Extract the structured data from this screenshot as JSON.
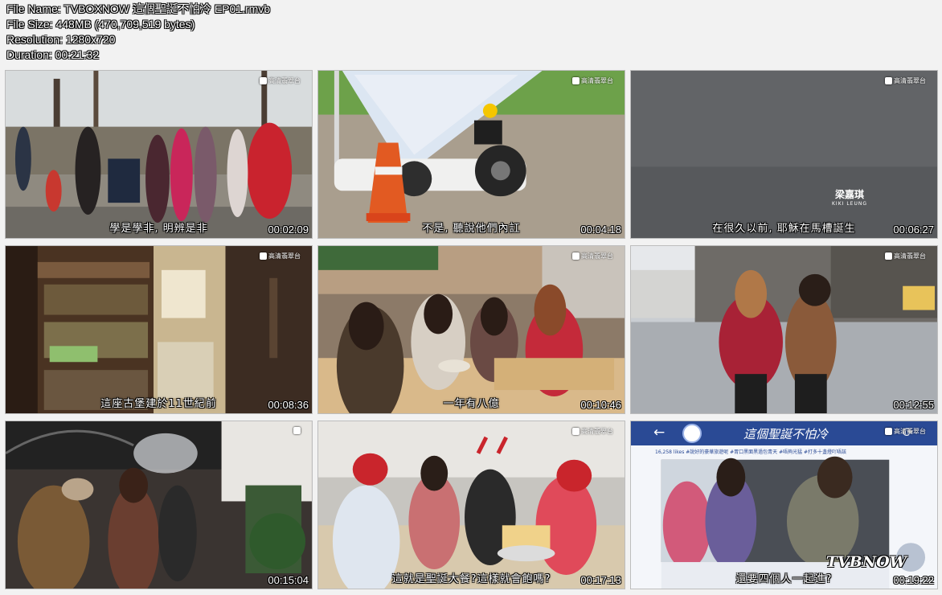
{
  "file_info": {
    "file_name": "File Name: TVBOXNOW 這個聖誕不怕冷 EP01.rmvb",
    "file_size": "File Size: 448MB (470,709,519 bytes)",
    "resolution": "Resolution: 1280x720",
    "duration": "Duration: 00:21:32"
  },
  "channel_logo_text": "高清翡翠台",
  "thumbnails": [
    {
      "timecode": "00:02:09",
      "subtitle": "學是學非, 明辨是非"
    },
    {
      "timecode": "00:04:18",
      "subtitle": "不是, 聽說他們內訌"
    },
    {
      "timecode": "00:06:27",
      "subtitle": "在很久以前, 耶穌在馬槽誕生",
      "credit_name": "梁嘉琪",
      "credit_en": "KIKI LEUNG"
    },
    {
      "timecode": "00:08:36",
      "subtitle": "這座古堡建於11世紀前"
    },
    {
      "timecode": "00:10:46",
      "subtitle": "一年有八億"
    },
    {
      "timecode": "00:12:55",
      "subtitle": ""
    },
    {
      "timecode": "00:15:04",
      "subtitle": ""
    },
    {
      "timecode": "00:17:13",
      "subtitle": "這就是聖誕大餐?這樣就會飽嗎?"
    },
    {
      "timecode": "00:19:22",
      "subtitle": "還要四個人一起進?",
      "app_title": "這個聖誕不怕冷",
      "likes_line": "16,258 likes  #說好的豪華旅遊呢 #胃口黑面黑過包青天 #唔夠光猛 #打多十盞燈吖唔該",
      "watermark": "TVBNOW"
    }
  ],
  "colors": {
    "background": "#f2f2f2",
    "app_bar": "#2a4a95"
  }
}
